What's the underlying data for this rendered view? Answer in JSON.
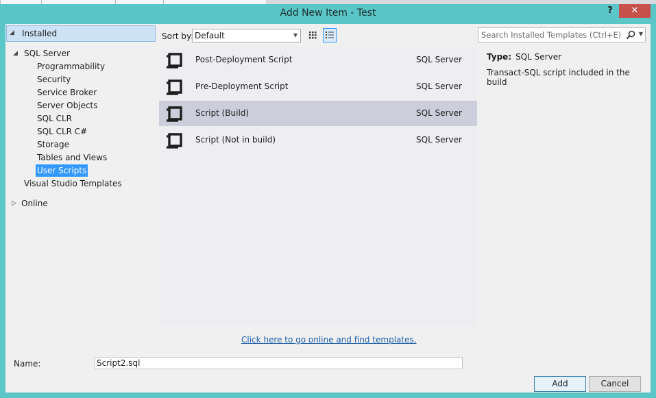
{
  "window": {
    "title": "Add New Item - Test",
    "help_label": "?",
    "close_label": "✕"
  },
  "tree": {
    "installed_label": "Installed",
    "sql_server_label": "SQL Server",
    "children": [
      "Programmability",
      "Security",
      "Service Broker",
      "Server Objects",
      "SQL CLR",
      "SQL CLR C#",
      "Storage",
      "Tables and Views",
      "User Scripts"
    ],
    "selected_child": "User Scripts",
    "vs_templates_label": "Visual Studio Templates",
    "online_label": "Online"
  },
  "toolbar": {
    "sort_label": "Sort by:",
    "sort_value": "Default"
  },
  "templates": [
    {
      "name": "Post-Deployment Script",
      "category": "SQL Server"
    },
    {
      "name": "Pre-Deployment Script",
      "category": "SQL Server"
    },
    {
      "name": "Script (Build)",
      "category": "SQL Server",
      "selected": true
    },
    {
      "name": "Script (Not in build)",
      "category": "SQL Server"
    }
  ],
  "search": {
    "placeholder": "Search Installed Templates (Ctrl+E)"
  },
  "details": {
    "type_label": "Type:",
    "type_value": "SQL Server",
    "description": "Transact-SQL script included in the build"
  },
  "online_link": "Click here to go online and find templates.",
  "name_field": {
    "label": "Name:",
    "value": "Script2.sql"
  },
  "buttons": {
    "add": "Add",
    "cancel": "Cancel"
  },
  "colors": {
    "frame": "#5bc6c7",
    "selection": "#3399ff",
    "selected_row": "#cccedb",
    "close": "#c7504b"
  }
}
